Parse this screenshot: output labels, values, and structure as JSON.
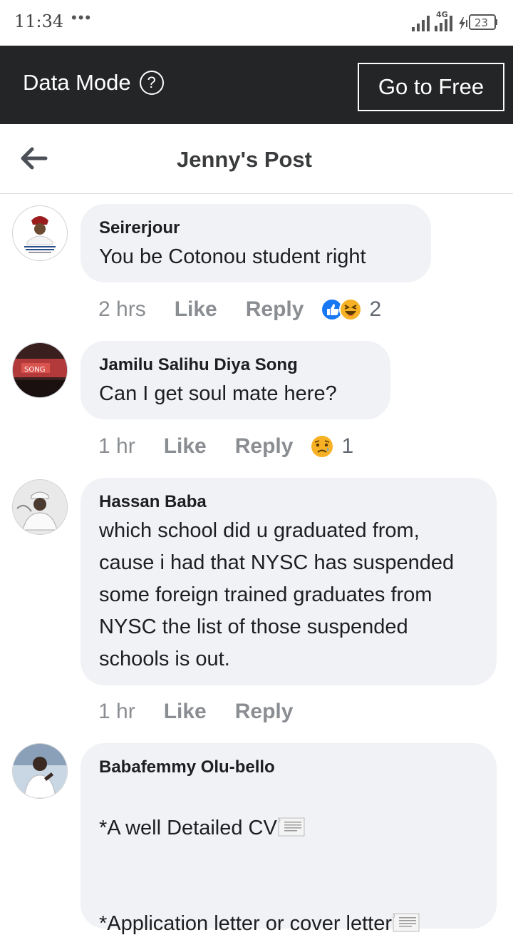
{
  "status_bar": {
    "time": "11:34",
    "dots": "•••",
    "network": "4G",
    "battery": "23"
  },
  "data_bar": {
    "label": "Data Mode",
    "help_icon": "?",
    "go_free_label": "Go to Free"
  },
  "header": {
    "title": "Jenny's Post"
  },
  "comments": [
    {
      "author": "Seirerjour",
      "text": "You be Cotonou student right",
      "time": "2 hrs",
      "like": "Like",
      "reply": "Reply",
      "reaction_icons": [
        "like-reaction-icon",
        "haha-reaction-icon"
      ],
      "reaction_count": "2"
    },
    {
      "author": "Jamilu Salihu Diya Song",
      "text": "Can I get soul mate here?",
      "time": "1 hr",
      "like": "Like",
      "reply": "Reply",
      "reaction_icons": [
        "sad-reaction-icon"
      ],
      "reaction_count": "1"
    },
    {
      "author": "Hassan Baba",
      "text": "which school did u graduated from, cause i had that NYSC has suspended some foreign trained graduates from NYSC the list of those suspended schools is out.",
      "time": "1 hr",
      "like": "Like",
      "reply": "Reply"
    },
    {
      "author": "Babafemmy Olu-bello",
      "line1": "*A well Detailed CV",
      "line2": "*Application letter or cover letter"
    }
  ],
  "colors": {
    "data_bar_bg": "#242526",
    "bubble_bg": "#f0f2f5",
    "meta_text": "#8a8d91",
    "like_blue": "#1877f2",
    "haha_yellow": "#f7b125"
  }
}
